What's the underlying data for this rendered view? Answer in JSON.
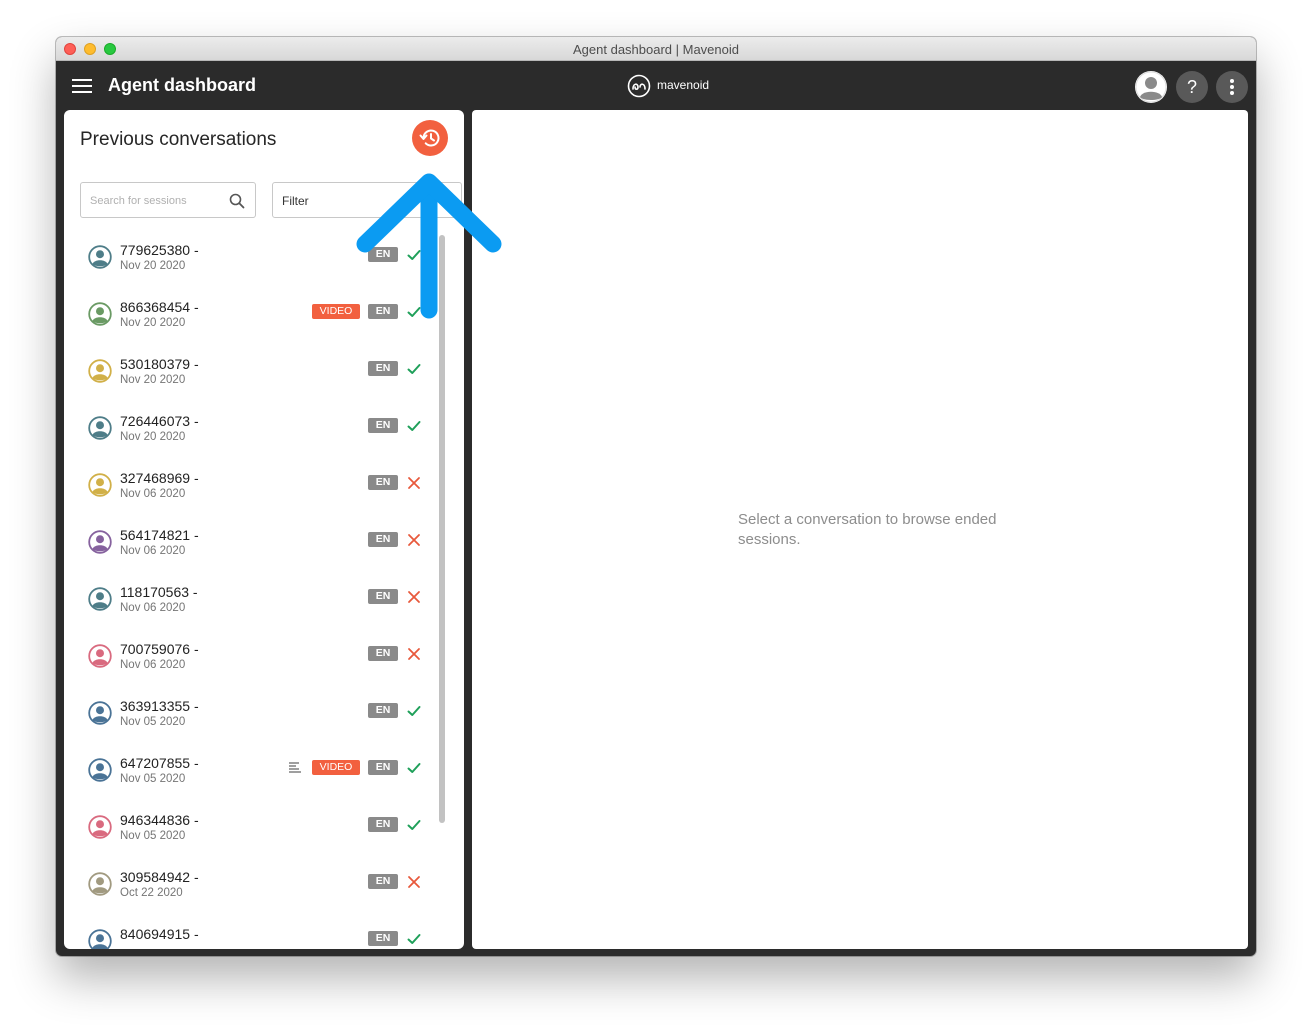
{
  "window": {
    "title": "Agent dashboard | Mavenoid"
  },
  "appbar": {
    "title": "Agent dashboard",
    "brand": "mavenoid",
    "help_label": "?"
  },
  "sidebar": {
    "title": "Previous conversations",
    "search_placeholder": "Search for sessions",
    "filter_label": "Filter"
  },
  "conversations": [
    {
      "id": "779625380 -",
      "date": "Nov 20 2020",
      "lang": "EN",
      "video": "",
      "notes": false,
      "status": "success",
      "avatar_color": "#4e7d88"
    },
    {
      "id": "866368454 -",
      "date": "Nov 20 2020",
      "lang": "EN",
      "video": "VIDEO",
      "notes": false,
      "status": "success",
      "avatar_color": "#6a9a64"
    },
    {
      "id": "530180379 -",
      "date": "Nov 20 2020",
      "lang": "EN",
      "video": "",
      "notes": false,
      "status": "success",
      "avatar_color": "#d1b048"
    },
    {
      "id": "726446073 -",
      "date": "Nov 20 2020",
      "lang": "EN",
      "video": "",
      "notes": false,
      "status": "success",
      "avatar_color": "#4e7d88"
    },
    {
      "id": "327468969 -",
      "date": "Nov 06 2020",
      "lang": "EN",
      "video": "",
      "notes": false,
      "status": "failure",
      "avatar_color": "#d1b048"
    },
    {
      "id": "564174821 -",
      "date": "Nov 06 2020",
      "lang": "EN",
      "video": "",
      "notes": false,
      "status": "failure",
      "avatar_color": "#86629e"
    },
    {
      "id": "118170563 -",
      "date": "Nov 06 2020",
      "lang": "EN",
      "video": "",
      "notes": false,
      "status": "failure",
      "avatar_color": "#4e7d88"
    },
    {
      "id": "700759076 -",
      "date": "Nov 06 2020",
      "lang": "EN",
      "video": "",
      "notes": false,
      "status": "failure",
      "avatar_color": "#d96a7f"
    },
    {
      "id": "363913355 -",
      "date": "Nov 05 2020",
      "lang": "EN",
      "video": "",
      "notes": false,
      "status": "success",
      "avatar_color": "#4a7396"
    },
    {
      "id": "647207855 -",
      "date": "Nov 05 2020",
      "lang": "EN",
      "video": "VIDEO",
      "notes": true,
      "status": "success",
      "avatar_color": "#4a7396"
    },
    {
      "id": "946344836 -",
      "date": "Nov 05 2020",
      "lang": "EN",
      "video": "",
      "notes": false,
      "status": "success",
      "avatar_color": "#d96a7f"
    },
    {
      "id": "309584942 -",
      "date": "Oct 22 2020",
      "lang": "EN",
      "video": "",
      "notes": false,
      "status": "failure",
      "avatar_color": "#a19a80"
    },
    {
      "id": "840694915 -",
      "date": "",
      "lang": "EN",
      "video": "",
      "notes": false,
      "status": "success",
      "avatar_color": "#4a7396"
    }
  ],
  "detail": {
    "empty_message": "Select a conversation to browse ended sessions."
  },
  "colors": {
    "accent": "#f2603f",
    "success": "#1fa05a",
    "failure": "#e8593c",
    "annotation_arrow": "#0b9bf2",
    "appbar_bg": "#2b2b2b"
  }
}
